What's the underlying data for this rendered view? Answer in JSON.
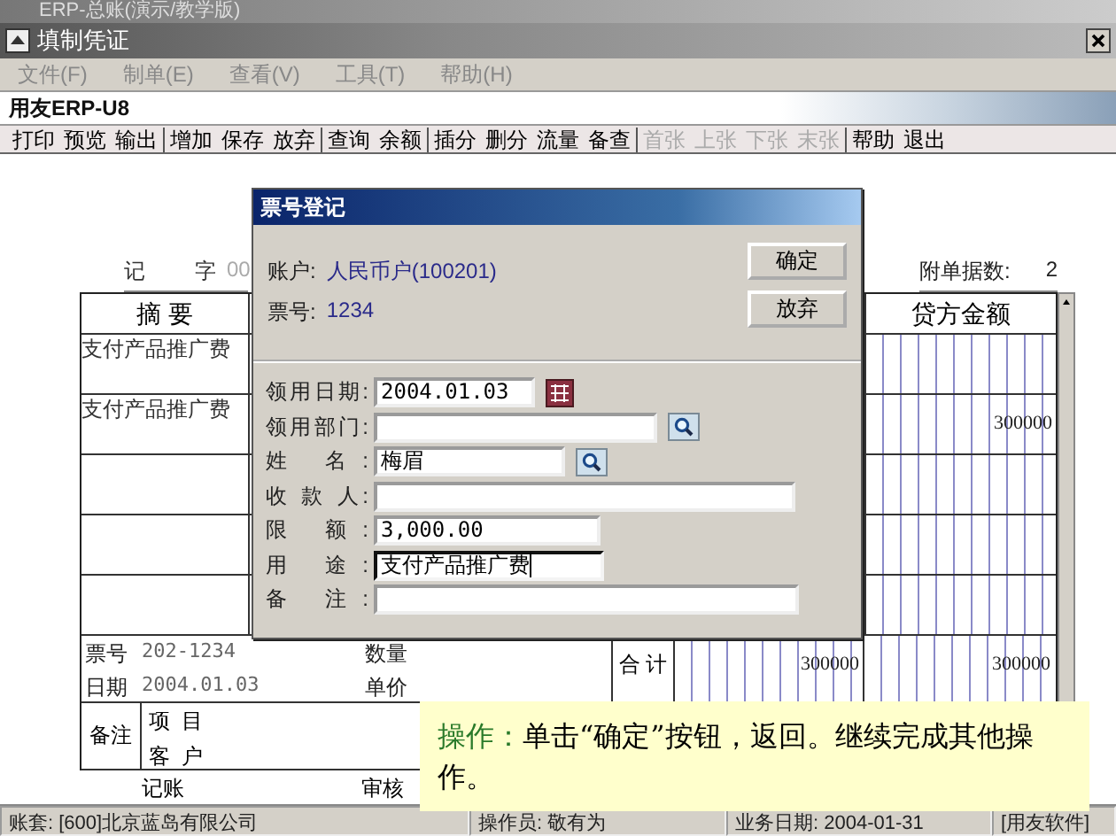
{
  "outer_window": {
    "title": "ERP-总账(演示/教学版)"
  },
  "window": {
    "title": "填制凭证"
  },
  "menu": [
    {
      "label": "文件(F)"
    },
    {
      "label": "制单(E)"
    },
    {
      "label": "查看(V)"
    },
    {
      "label": "工具(T)"
    },
    {
      "label": "帮助(H)"
    }
  ],
  "logo": "用友ERP-U8",
  "toolbar": [
    [
      {
        "label": "打印",
        "disabled": false
      },
      {
        "label": "预览",
        "disabled": false
      },
      {
        "label": "输出",
        "disabled": false
      }
    ],
    [
      {
        "label": "增加",
        "disabled": false
      },
      {
        "label": "保存",
        "disabled": false
      },
      {
        "label": "放弃",
        "disabled": false
      }
    ],
    [
      {
        "label": "查询",
        "disabled": false
      },
      {
        "label": "余额",
        "disabled": false
      }
    ],
    [
      {
        "label": "插分",
        "disabled": false
      },
      {
        "label": "删分",
        "disabled": false
      },
      {
        "label": "流量",
        "disabled": false
      },
      {
        "label": "备查",
        "disabled": false
      }
    ],
    [
      {
        "label": "首张",
        "disabled": true
      },
      {
        "label": "上张",
        "disabled": true
      },
      {
        "label": "下张",
        "disabled": true
      },
      {
        "label": "末张",
        "disabled": true
      }
    ],
    [
      {
        "label": "帮助",
        "disabled": false
      },
      {
        "label": "退出",
        "disabled": false
      }
    ]
  ],
  "voucher": {
    "type": "记",
    "word": "字",
    "number": "00",
    "attachments_label": "附单据数:",
    "attachments": "2",
    "summary_header": "摘 要",
    "credit_header": "贷方金额",
    "rows": [
      {
        "summary": "支付产品推广费"
      },
      {
        "summary": "支付产品推广费",
        "credit": "300000"
      },
      {},
      {},
      {}
    ],
    "footer": {
      "ticket_label": "票号",
      "ticket": "202-1234",
      "date_label": "日期",
      "date": "2004.01.03",
      "qty_label": "数量",
      "price_label": "单价",
      "total_label": "合 计",
      "total_debit": "300000",
      "total_credit": "300000"
    },
    "note": {
      "label": "备注",
      "project_label": "项  目",
      "customer_label": "客  户"
    },
    "signatures": [
      "记账",
      "审核"
    ]
  },
  "dialog": {
    "title": "票号登记",
    "account_label": "账户:",
    "account": "人民币户(100201)",
    "ticket_label": "票号:",
    "ticket": "1234",
    "buttons": [
      "确定",
      "放弃"
    ],
    "fields": [
      {
        "label": "领用日期:",
        "value": "2004.01.03",
        "kind": "calendar",
        "focused": false
      },
      {
        "label": "领用部门:",
        "kind": "search",
        "focused": false
      },
      {
        "label": "姓 名:",
        "value": "梅眉",
        "kind": "search",
        "focused": false
      },
      {
        "label": "收 款 人:",
        "kind": "plain",
        "focused": false
      },
      {
        "label": "限 额:",
        "value": "3,000.00",
        "kind": "plain",
        "focused": false
      },
      {
        "label": "用 途:",
        "value": "支付产品推广费",
        "kind": "plain",
        "focused": true
      },
      {
        "label": "备 注:",
        "kind": "plain",
        "focused": false
      }
    ]
  },
  "tip": {
    "label": "操作：",
    "text": "单击“确定”按钮，返回。继续完成其他操作。"
  },
  "status_bar": [
    "账套: [600]北京蓝岛有限公司",
    "操作员: 敬有为",
    "业务日期: 2004-01-31",
    "[用友软件]"
  ]
}
